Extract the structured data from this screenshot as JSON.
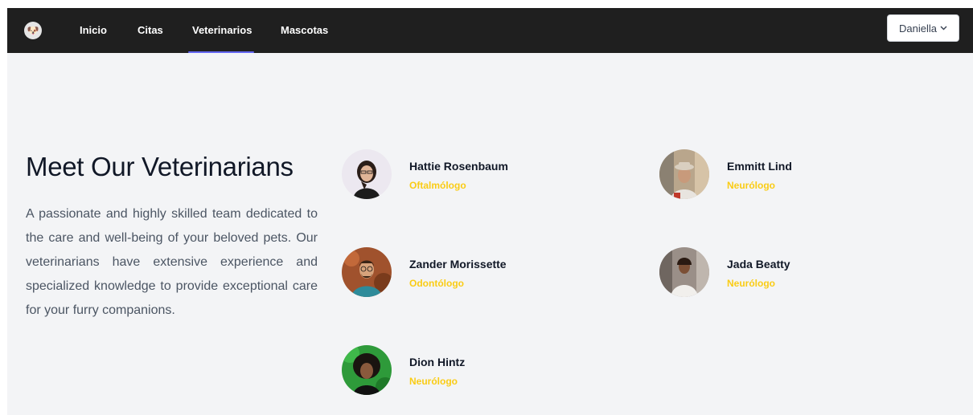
{
  "navbar": {
    "logo_icon": "dog-logo-icon",
    "links": [
      {
        "label": "Inicio"
      },
      {
        "label": "Citas"
      },
      {
        "label": "Veterinarios",
        "active": true
      },
      {
        "label": "Mascotas"
      }
    ],
    "user": {
      "label": "Daniella",
      "icon": "chevron-down-icon"
    },
    "active_color": "#6366f1"
  },
  "hero": {
    "title": "Meet Our Veterinarians",
    "description": "A passionate and highly skilled team dedicated to the care and well-being of your beloved pets. Our veterinarians have extensive experience and specialized knowledge to provide exceptional care for your furry companions."
  },
  "veterinarians": [
    {
      "name": "Hattie Rosenbaum",
      "specialty": "Oftalmólogo"
    },
    {
      "name": "Emmitt Lind",
      "specialty": "Neurólogo"
    },
    {
      "name": "Zander Morissette",
      "specialty": "Odontólogo"
    },
    {
      "name": "Jada Beatty",
      "specialty": "Neurólogo"
    },
    {
      "name": "Dion Hintz",
      "specialty": "Neurólogo"
    }
  ],
  "colors": {
    "navbar_bg": "#1f1f1f",
    "page_bg": "#f3f4f6",
    "specialty": "#facc15"
  }
}
